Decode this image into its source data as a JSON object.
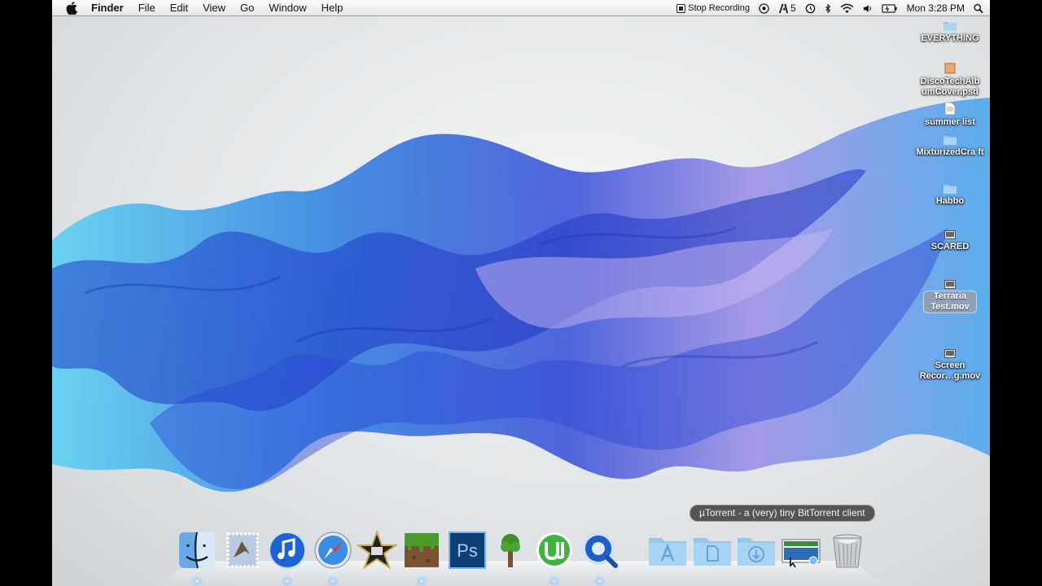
{
  "menubar": {
    "app_name": "Finder",
    "menus": [
      "File",
      "Edit",
      "View",
      "Go",
      "Window",
      "Help"
    ],
    "stop_recording": "Stop Recording",
    "adobe_badge": "5",
    "clock": "Mon 3:28 PM"
  },
  "desktop_icons": [
    {
      "label": "EVERYTHING",
      "icon": "folder-icon"
    },
    {
      "label": "DiscoTechAlb umCover.psd",
      "icon": "psd-file-icon"
    },
    {
      "label": "summer list",
      "icon": "text-file-icon"
    },
    {
      "label": "MixturizedCra ft",
      "icon": "folder-icon"
    },
    {
      "label": "Habbo",
      "icon": "folder-icon"
    },
    {
      "label": "SCARED",
      "icon": "movie-file-icon"
    },
    {
      "label": "Terraria Test.mov",
      "icon": "movie-file-icon"
    },
    {
      "label": "Screen Recor…g.mov",
      "icon": "movie-file-icon"
    }
  ],
  "dock": {
    "tooltip": "µTorrent - a (very) tiny BitTorrent client",
    "apps": [
      "Finder",
      "Mail",
      "iTunes",
      "Safari",
      "iMovie",
      "Minecraft",
      "Photoshop",
      "Terraria",
      "µTorrent",
      "QuickTime Player",
      "Applications",
      "Documents",
      "Downloads",
      "Screen capture",
      "Trash"
    ],
    "ps_label": "Ps"
  },
  "colors": {
    "accent_blue": "#1e4fd6",
    "wallpaper_light": "#56c6ee",
    "wallpaper_violet": "#8f7be8"
  }
}
